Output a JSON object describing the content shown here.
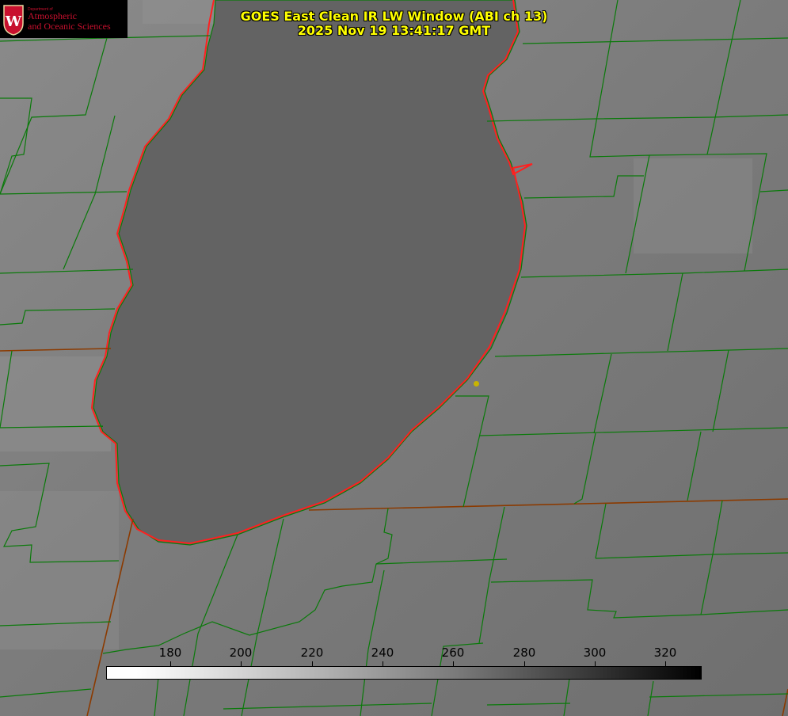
{
  "title": {
    "line1": "GOES East Clean IR LW Window (ABI ch 13)",
    "line2": "2025 Nov 19 13:41:17 GMT"
  },
  "logo": {
    "dept": "Department of",
    "line1": "Atmospheric",
    "line2": "and Oceanic Sciences",
    "crest_letter": "W"
  },
  "colorbar": {
    "ticks": [
      "180",
      "200",
      "220",
      "240",
      "260",
      "280",
      "300",
      "320"
    ]
  },
  "colors": {
    "title": "#ffff00",
    "coastline": "#ff2020",
    "county_lines": "#008000",
    "state_lines": "#8b3a00",
    "background_gray": "#7a7a7a",
    "lake_gray": "#626262"
  }
}
